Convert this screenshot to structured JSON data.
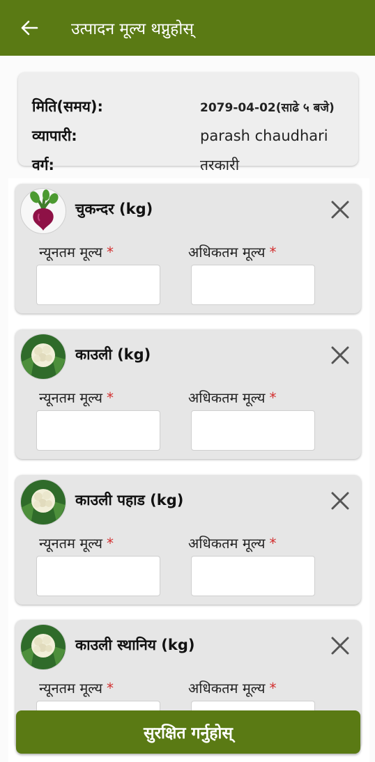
{
  "appbar": {
    "title": "उत्पादन मूल्य थप्नुहोस्",
    "back_icon": "back-arrow-icon"
  },
  "info": {
    "date_label": "मिति(समय):",
    "date_value": "2079-04-02(साढे ५ बजे)",
    "trader_label": "व्यापारी:",
    "trader_value": "parash  chaudhari",
    "category_label": "वर्ग:",
    "category_value": "तरकारी"
  },
  "products": [
    {
      "name": "चुकन्दर (kg)",
      "image": "beetroot-image",
      "min_label": "न्यूनतम मूल्य",
      "max_label": "अधिकतम मूल्य",
      "required_mark": "*",
      "min_value": "",
      "max_value": ""
    },
    {
      "name": "काउली (kg)",
      "image": "cauliflower-image",
      "min_label": "न्यूनतम मूल्य",
      "max_label": "अधिकतम मूल्य",
      "required_mark": "*",
      "min_value": "",
      "max_value": ""
    },
    {
      "name": "काउली पहाड (kg)",
      "image": "cauliflower-image",
      "min_label": "न्यूनतम मूल्य",
      "max_label": "अधिकतम मूल्य",
      "required_mark": "*",
      "min_value": "",
      "max_value": ""
    },
    {
      "name": "काउली स्थानिय (kg)",
      "image": "cauliflower-image",
      "min_label": "न्यूनतम मूल्य",
      "max_label": "अधिकतम मूल्य",
      "required_mark": "*",
      "min_value": "",
      "max_value": ""
    }
  ],
  "save_button": "सुरक्षित गर्नुहोस्",
  "colors": {
    "primary": "#5a7a14",
    "required": "#d32f2f",
    "card": "#e6e6e6"
  }
}
